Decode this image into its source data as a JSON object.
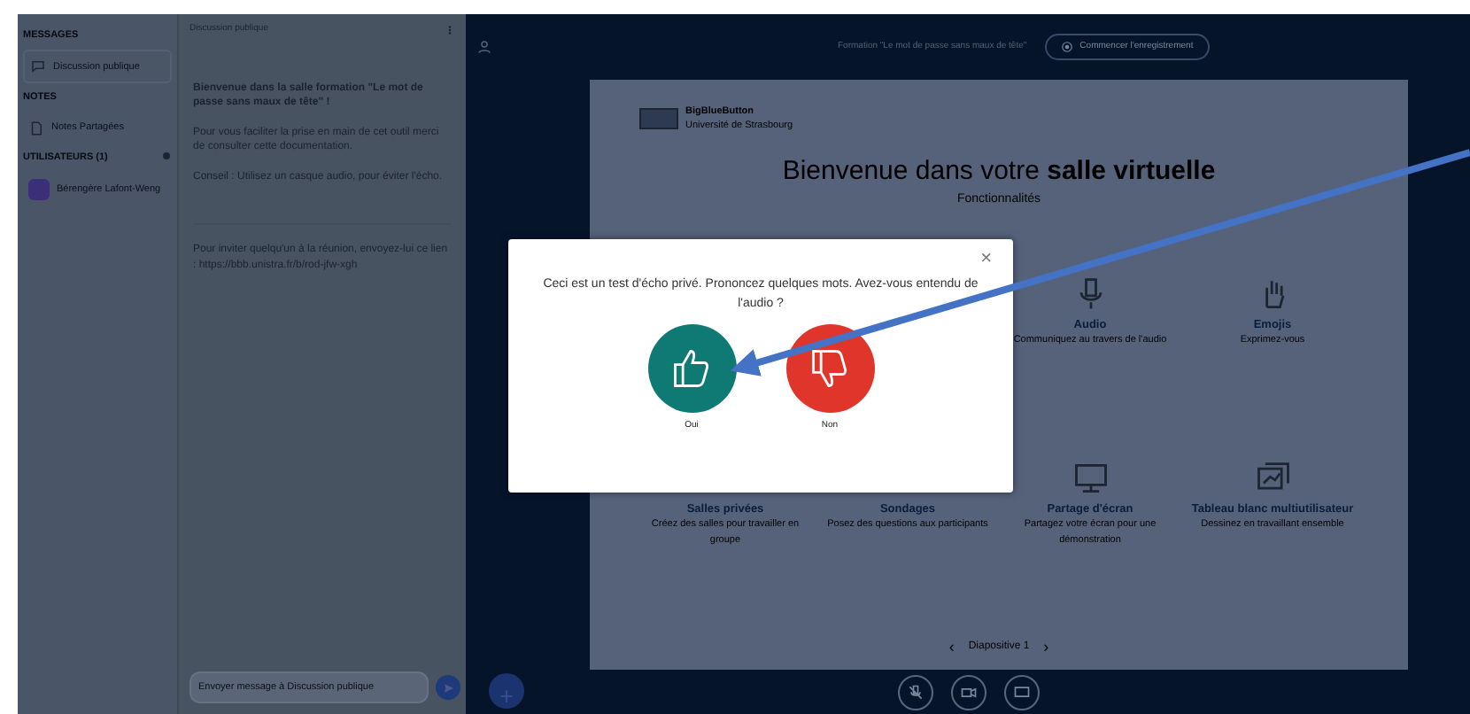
{
  "users_panel": {
    "messages_heading": "MESSAGES",
    "chat_item": {
      "label": "Discussion publique",
      "selected": true
    },
    "notes_heading": "NOTES",
    "notes_item": {
      "label": "Notes Partagées"
    },
    "users_heading": "UTILISATEURS (1)",
    "users": [
      {
        "name": "Bérengère Lafont-Weng"
      }
    ]
  },
  "chat": {
    "title": "Discussion publique",
    "messages": [
      {
        "text": "**Bienvenue dans la salle formation \"Le mot de passe sans maux de tête\" !**"
      },
      {
        "text": "Pour vous faciliter la prise en main de cet outil merci de consulter cette documentation."
      },
      {
        "text": "Conseil : Utilisez un casque audio, pour éviter l'écho."
      },
      {
        "text": "Pour inviter quelqu'un à la réunion, envoyez-lui ce lien : https://bbb.unistra.fr/b/rod-jfw-xgh"
      }
    ],
    "input": {
      "placeholder": "Envoyer message à Discussion publique"
    }
  },
  "topbar": {
    "title": "Formation \"Le mot de passe sans maux de tête\"",
    "record_button": "Commencer l'enregistrement"
  },
  "slide": {
    "logo_name": "BigBlueButton",
    "logo_org": "Université de Strasbourg",
    "heading": "Bienvenue dans votre **salle virtuelle**",
    "subheading": "Fonctionnalités",
    "features": [
      {
        "kind": "audio",
        "title": "Audio",
        "text": "Communiquez au travers de l'audio"
      },
      {
        "kind": "emoji",
        "title": "Emojis",
        "text": "Exprimez-vous"
      },
      {
        "kind": "rooms",
        "title": "Salles privées",
        "text": "Créez des salles pour travailler en groupe"
      },
      {
        "kind": "poll",
        "title": "Sondages",
        "text": "Posez des questions aux participants"
      },
      {
        "kind": "screen",
        "title": "Partage d'écran",
        "text": "Partagez votre écran pour une démonstration"
      },
      {
        "kind": "whiteboard",
        "title": "Tableau blanc multiutilisateur",
        "text": "Dessinez en travaillant ensemble"
      }
    ],
    "prev": "‹",
    "page_label": "Diapositive 1",
    "next": "›"
  },
  "modal": {
    "text": "Ceci est un test d'écho privé. Prononcez quelques mots. Avez-vous entendu de l'audio ?",
    "close": "×",
    "buttons": [
      {
        "kind": "yes",
        "label": "Oui"
      },
      {
        "kind": "no",
        "label": "Non"
      }
    ]
  }
}
